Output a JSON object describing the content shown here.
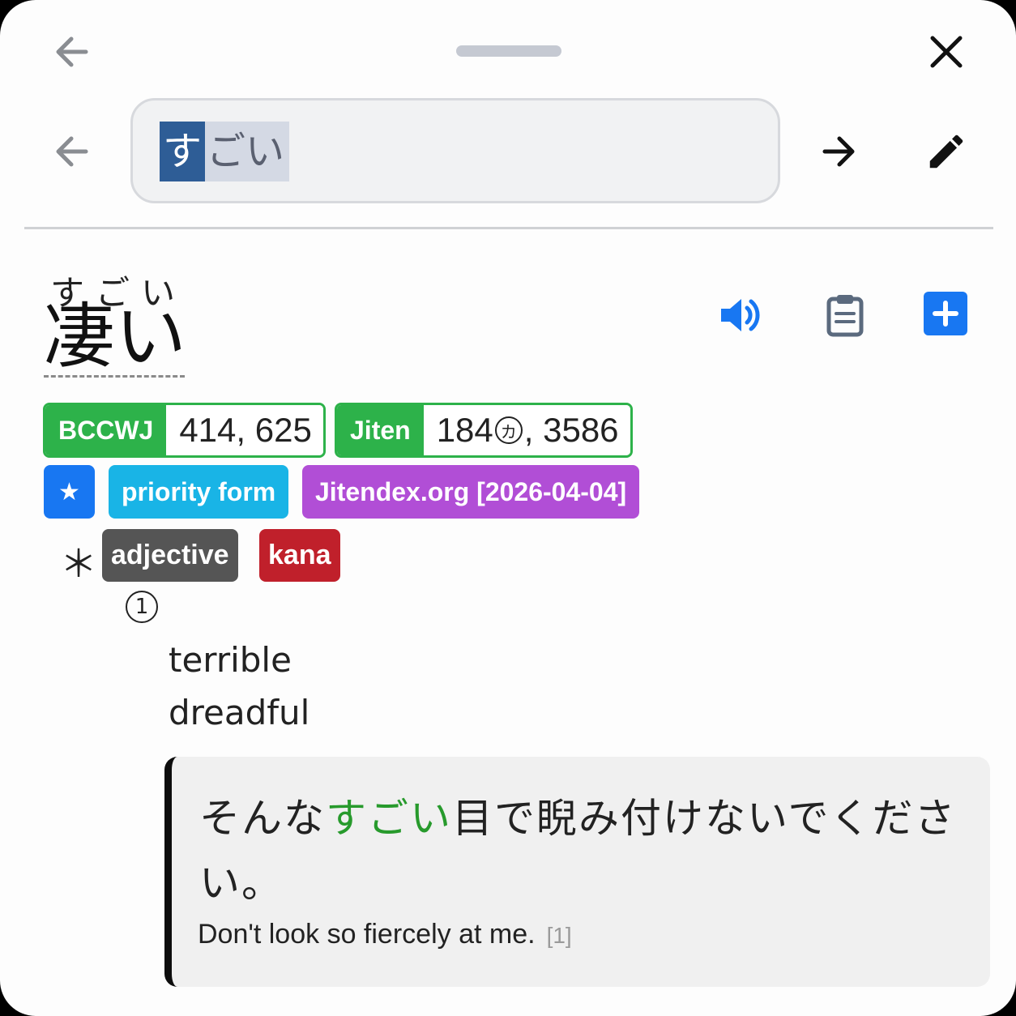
{
  "search": {
    "query_selected": "す",
    "query_rest": "ごい"
  },
  "entry": {
    "reading": "すごい",
    "headword": "凄い"
  },
  "frequency_tags": [
    {
      "label": "BCCWJ",
      "value": "414, 625"
    },
    {
      "label": "Jiten",
      "value_main": "184",
      "value_mark": "カ",
      "value_tail": ", 3586"
    }
  ],
  "tags": {
    "star": "★",
    "priority": "priority form",
    "dictionary": "Jitendex.org [2026-04-04]",
    "pos_marker": "＊",
    "pos": "adjective",
    "kana": "kana"
  },
  "sense": {
    "number": "1",
    "glosses": [
      "terrible",
      "dreadful"
    ]
  },
  "example": {
    "jp_before": "そんな",
    "jp_highlight": "すごい",
    "jp_after": "目で睨み付けないでください。",
    "en": "Don't look so fiercely at me.",
    "ref": "[1]"
  },
  "colors": {
    "freq_green": "#2db24a",
    "star_blue": "#1877f2",
    "priority_cyan": "#19b4e6",
    "dict_purple": "#b14ed6",
    "pos_gray": "#555555",
    "kana_red": "#c0202b",
    "audio_blue": "#1877f2",
    "add_blue": "#1877f2"
  },
  "icons": {
    "back_top": "arrow-left-icon",
    "close": "close-icon",
    "back_search": "arrow-left-icon",
    "forward": "arrow-right-icon",
    "edit": "pencil-icon",
    "audio": "speaker-icon",
    "clipboard": "clipboard-icon",
    "add": "plus-square-icon"
  }
}
